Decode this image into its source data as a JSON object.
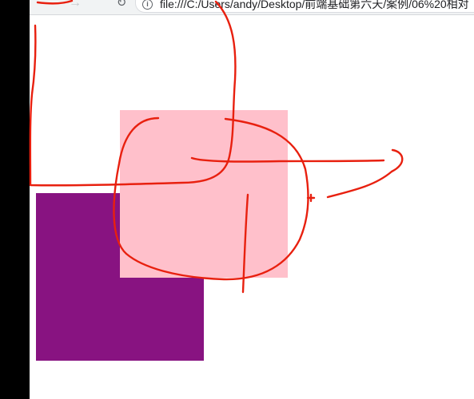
{
  "browser": {
    "url": "file:///C:/Users/andy/Desktop/前端基础第六天/案例/06%20相对",
    "info_icon": "info-icon",
    "reload_icon": "reload-icon",
    "forward_icon": "forward-arrow-icon"
  },
  "page": {
    "boxes": [
      {
        "color": "#ffc0cb",
        "name": "pink"
      },
      {
        "color": "#881381",
        "name": "purple"
      }
    ],
    "annotation_color": "#e8200f"
  }
}
